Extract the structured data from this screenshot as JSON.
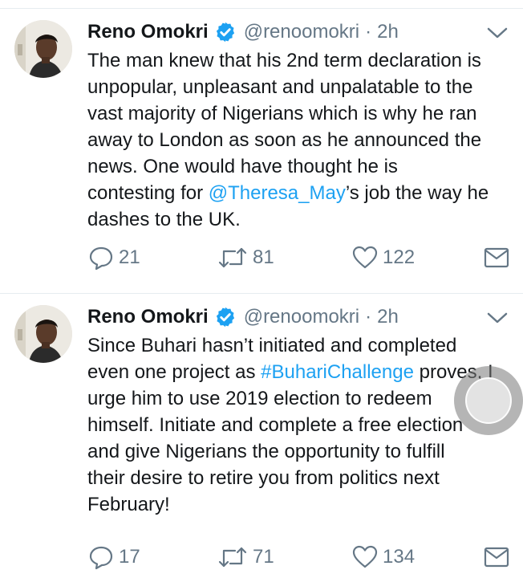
{
  "colors": {
    "text": "#14171a",
    "muted": "#657786",
    "link": "#1da1f2",
    "verified": "#1da1f2",
    "divider": "#e6ecf0"
  },
  "icons": {
    "verified": "verified-badge-icon",
    "caret": "chevron-down-icon",
    "reply": "reply-icon",
    "retweet": "retweet-icon",
    "like": "heart-icon",
    "dm": "envelope-icon"
  },
  "tweets": [
    {
      "name": "Reno Omokri",
      "handle": "@renoomokri",
      "separator": "·",
      "time": "2h",
      "lines": [
        {
          "text": "The man knew that his 2nd term declaration is"
        },
        {
          "text": "unpopular, unpleasant and unpalatable to the"
        },
        {
          "text": "vast majority of Nigerians which is why he ran"
        },
        {
          "text": "away to London as soon as he announced the"
        },
        {
          "text": "news. One would have thought he is"
        },
        {
          "pre": "contesting for ",
          "link": "@Theresa_May",
          "post": "’s job the way he"
        },
        {
          "text": "dashes to the UK."
        }
      ],
      "replies": "21",
      "retweets": "81",
      "likes": "122"
    },
    {
      "name": "Reno Omokri",
      "handle": "@renoomokri",
      "separator": "·",
      "time": "2h",
      "lines": [
        {
          "text": "Since Buhari hasn’t initiated and completed"
        },
        {
          "pre": "even one project as ",
          "link": "#BuhariChallenge",
          "post": " proves, I"
        },
        {
          "text": "urge him to use 2019 election to redeem"
        },
        {
          "text": "himself. Initiate and complete a free election"
        },
        {
          "text": "and give Nigerians the opportunity to fulfill"
        },
        {
          "text": "their desire to retire you from politics next"
        },
        {
          "text": "February!"
        }
      ],
      "replies": "17",
      "retweets": "71",
      "likes": "134"
    }
  ]
}
